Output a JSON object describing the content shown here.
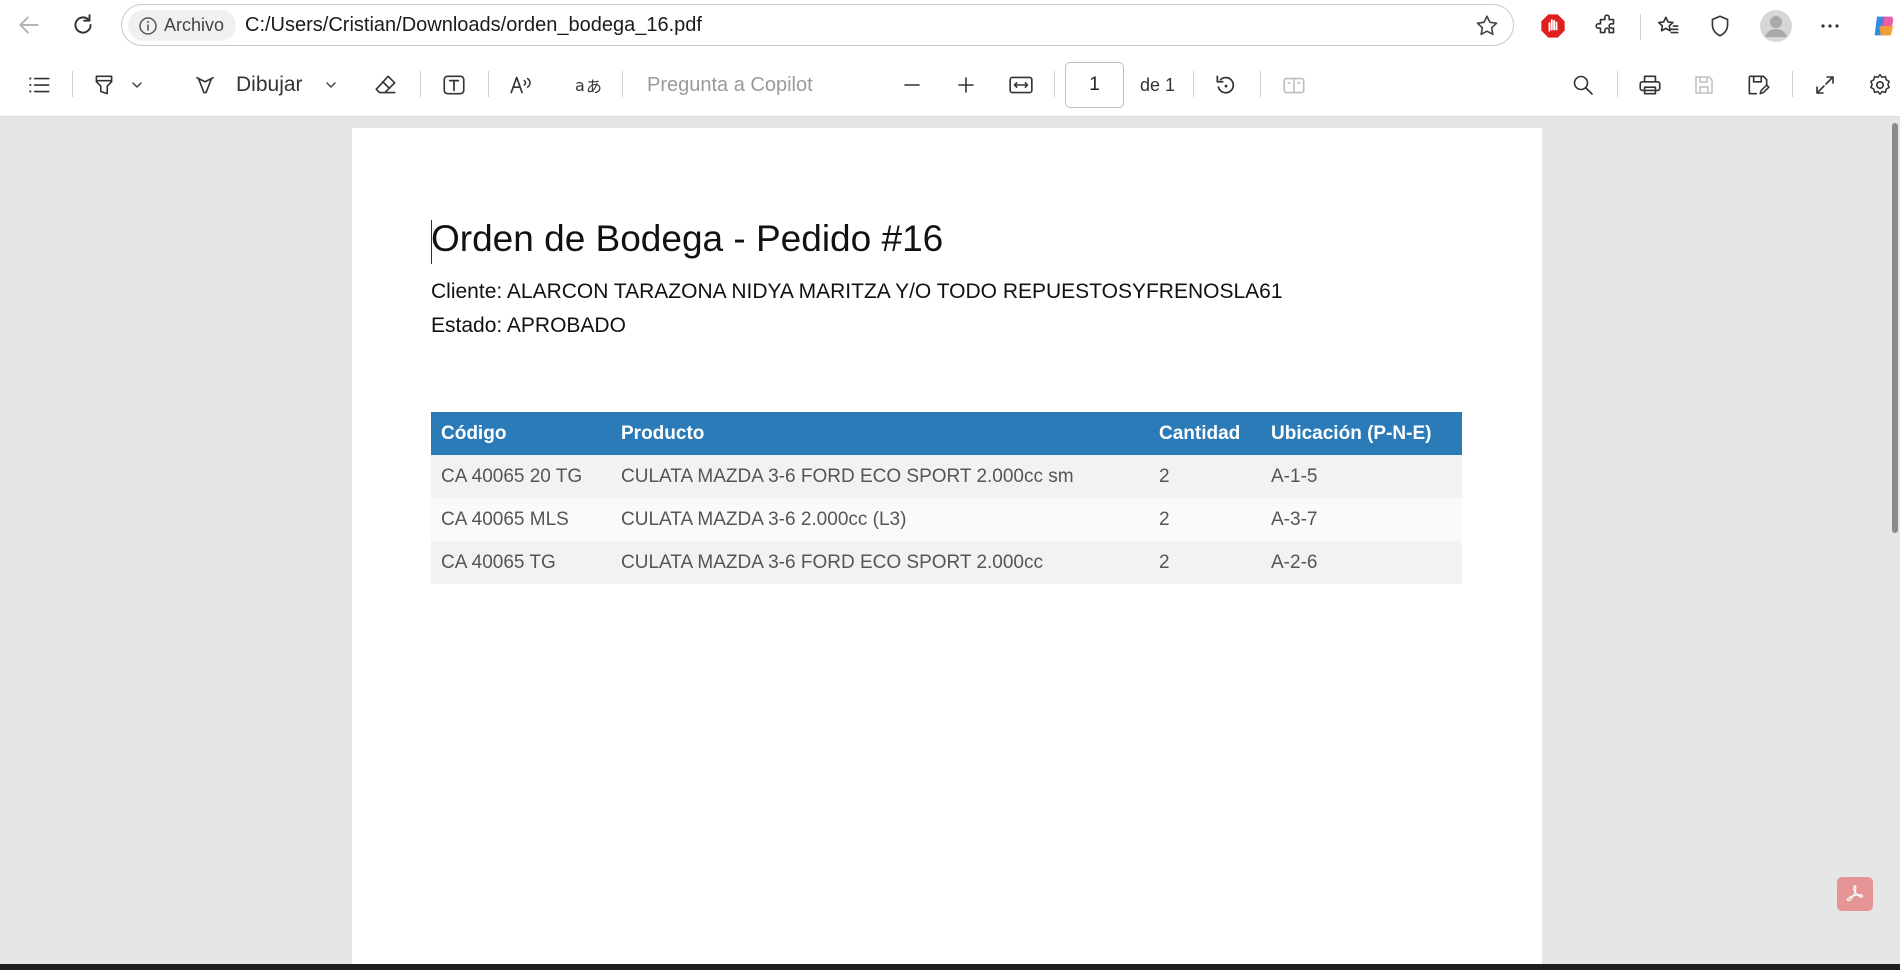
{
  "browser": {
    "url_chip_label": "Archivo",
    "url": "C:/Users/Cristian/Downloads/orden_bodega_16.pdf"
  },
  "toolbar": {
    "draw_label": "Dibujar",
    "copilot_placeholder": "Pregunta a Copilot",
    "page_current": "1",
    "page_total_label": "de 1"
  },
  "document": {
    "title": "Orden de Bodega - Pedido #16",
    "client_line": "Cliente: ALARCON TARAZONA NIDYA MARITZA Y/O TODO REPUESTOSYFRENOSLA61",
    "status_line": "Estado: APROBADO",
    "table": {
      "headers": [
        "Código",
        "Producto",
        "Cantidad",
        "Ubicación (P-N-E)"
      ],
      "rows": [
        [
          "CA 40065 20 TG",
          "CULATA MAZDA 3-6  FORD  ECO SPORT 2.000cc sm",
          "2",
          "A-1-5"
        ],
        [
          "CA 40065 MLS",
          "CULATA  MAZDA 3-6  2.000cc (L3)",
          "2",
          "A-3-7"
        ],
        [
          "CA 40065 TG",
          "CULATA MAZDA 3-6  FORD  ECO SPORT 2.000cc",
          "2",
          "A-2-6"
        ]
      ]
    }
  },
  "colors": {
    "table_header": "#2b7bb9",
    "blocked_icon": "#e0201f"
  }
}
